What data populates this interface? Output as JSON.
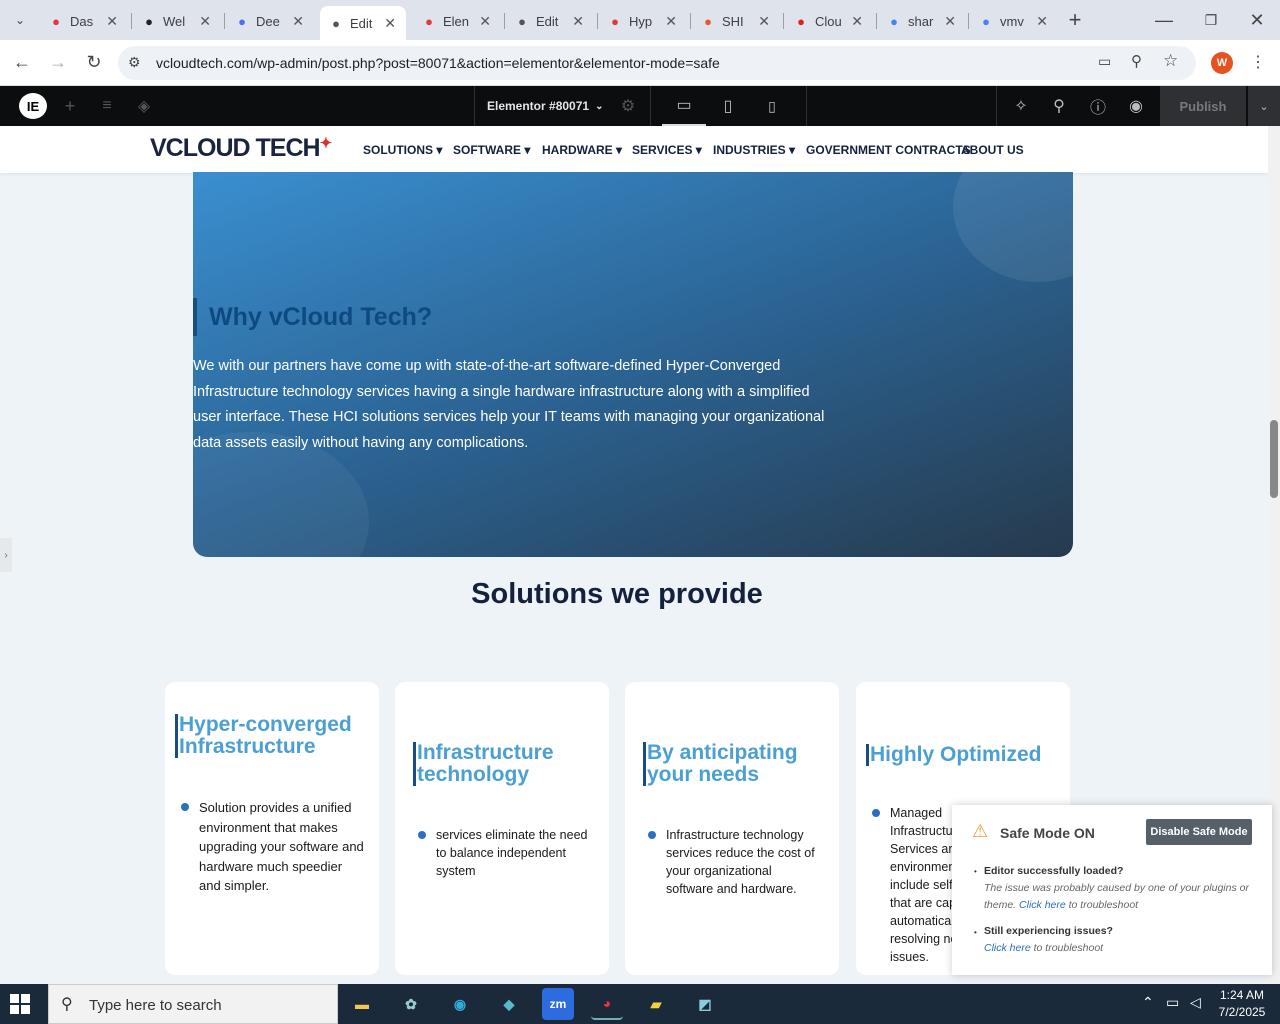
{
  "tabs": [
    {
      "title": "Das",
      "icon": "elementor-icon",
      "color": "#e2373f",
      "active": false
    },
    {
      "title": "Wel",
      "icon": "wordpress-icon",
      "color": "#222",
      "active": false
    },
    {
      "title": "Dee",
      "icon": "deepseek-icon",
      "color": "#4d6bfe",
      "active": false
    },
    {
      "title": "Edit",
      "icon": "globe-icon",
      "color": "#555",
      "active": true
    },
    {
      "title": "Elen",
      "icon": "elementor-icon",
      "color": "#e2373f",
      "active": false
    },
    {
      "title": "Edit",
      "icon": "globe-icon",
      "color": "#555",
      "active": false
    },
    {
      "title": "Hyp",
      "icon": "elementor-icon",
      "color": "#e2373f",
      "active": false
    },
    {
      "title": "SHI",
      "icon": "shi-icon",
      "color": "#e53",
      "active": false
    },
    {
      "title": "Clou",
      "icon": "cloud-icon",
      "color": "#d22",
      "active": false
    },
    {
      "title": "shar",
      "icon": "google-icon",
      "color": "#4285f4",
      "active": false
    },
    {
      "title": "vmv",
      "icon": "google-icon",
      "color": "#4285f4",
      "active": false
    }
  ],
  "browser": {
    "url": "vcloudtech.com/wp-admin/post.php?post=80071&action=elementor&elementor-mode=safe",
    "profile_initial": "W"
  },
  "editor": {
    "doc_title": "Elementor #80071",
    "publish_label": "Publish"
  },
  "site": {
    "logo_text": "VCLOUD TECH",
    "menu": [
      "SOLUTIONS ▾",
      "SOFTWARE ▾",
      "HARDWARE ▾",
      "SERVICES ▾",
      "INDUSTRIES ▾",
      "GOVERNMENT CONTRACTS",
      "ABOUT US"
    ],
    "hero": {
      "heading": "Why vCloud Tech?",
      "body": "We with our partners have come up with state-of-the-art software-defined Hyper-Converged Infrastructure technology services having a single hardware infrastructure along with a simplified user interface. These HCI solutions services help your IT teams with managing your organizational data assets easily without having any complications."
    },
    "solutions_title": "Solutions we provide",
    "cards": [
      {
        "title": "Hyper-converged Infrastructure",
        "text": "Solution provides a unified environment that makes upgrading your software and hardware much speedier and simpler."
      },
      {
        "title": "Infrastructure technology",
        "text": "services eliminate the need to balance independent system"
      },
      {
        "title": "By anticipating your needs",
        "text": "Infrastructure technology services reduce the cost of your organizational software and hardware."
      },
      {
        "title": "Highly Optimized",
        "text": "Managed Infrastructure Services are environment include self- that are cap automaticall resolving ne issues."
      }
    ]
  },
  "safe_mode": {
    "title": "Safe Mode ON",
    "button": "Disable Safe Mode",
    "item1_title": "Editor successfully loaded?",
    "item1_text": "The issue was probably caused by one of your plugins or theme.",
    "item1_link": "Click here",
    "item1_suffix": " to troubleshoot",
    "item2_title": "Still experiencing issues?",
    "item2_link": "Click here",
    "item2_suffix": " to troubleshoot"
  },
  "taskbar": {
    "search_placeholder": "Type here to search",
    "time": "1:24 AM",
    "date": "7/2/2025"
  }
}
